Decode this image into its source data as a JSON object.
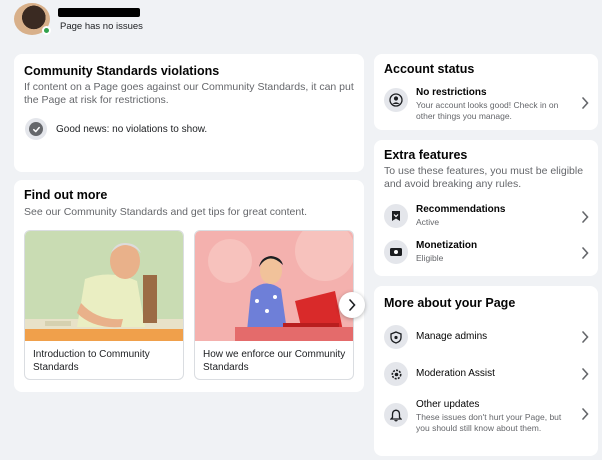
{
  "header": {
    "status": "Page has no issues"
  },
  "violations": {
    "title": "Community Standards violations",
    "description": "If content on a Page goes against our Community Standards, it can put the Page at risk for restrictions.",
    "status_text": "Good news: no violations to show."
  },
  "find_out_more": {
    "title": "Find out more",
    "description": "See our Community Standards and get tips for great content.",
    "cards": [
      {
        "label": "Introduction to Community Standards"
      },
      {
        "label": "How we enforce our Community Standards"
      }
    ]
  },
  "account_status": {
    "title": "Account status",
    "item_title": "No restrictions",
    "item_sub": "Your account looks good! Check in on other things you manage."
  },
  "extra_features": {
    "title": "Extra features",
    "description": "To use these features, you must be eligible and avoid breaking any rules.",
    "items": [
      {
        "title": "Recommendations",
        "sub": "Active"
      },
      {
        "title": "Monetization",
        "sub": "Eligible"
      }
    ]
  },
  "more_about": {
    "title": "More about your Page",
    "items": [
      {
        "title": "Manage admins"
      },
      {
        "title": "Moderation Assist"
      },
      {
        "title": "Other updates",
        "sub": "These issues don't hurt your Page, but you should still know about them."
      }
    ]
  },
  "colors": {
    "background": "#f0f2f5",
    "online": "#31a24c",
    "secondary_text": "#65676b"
  }
}
